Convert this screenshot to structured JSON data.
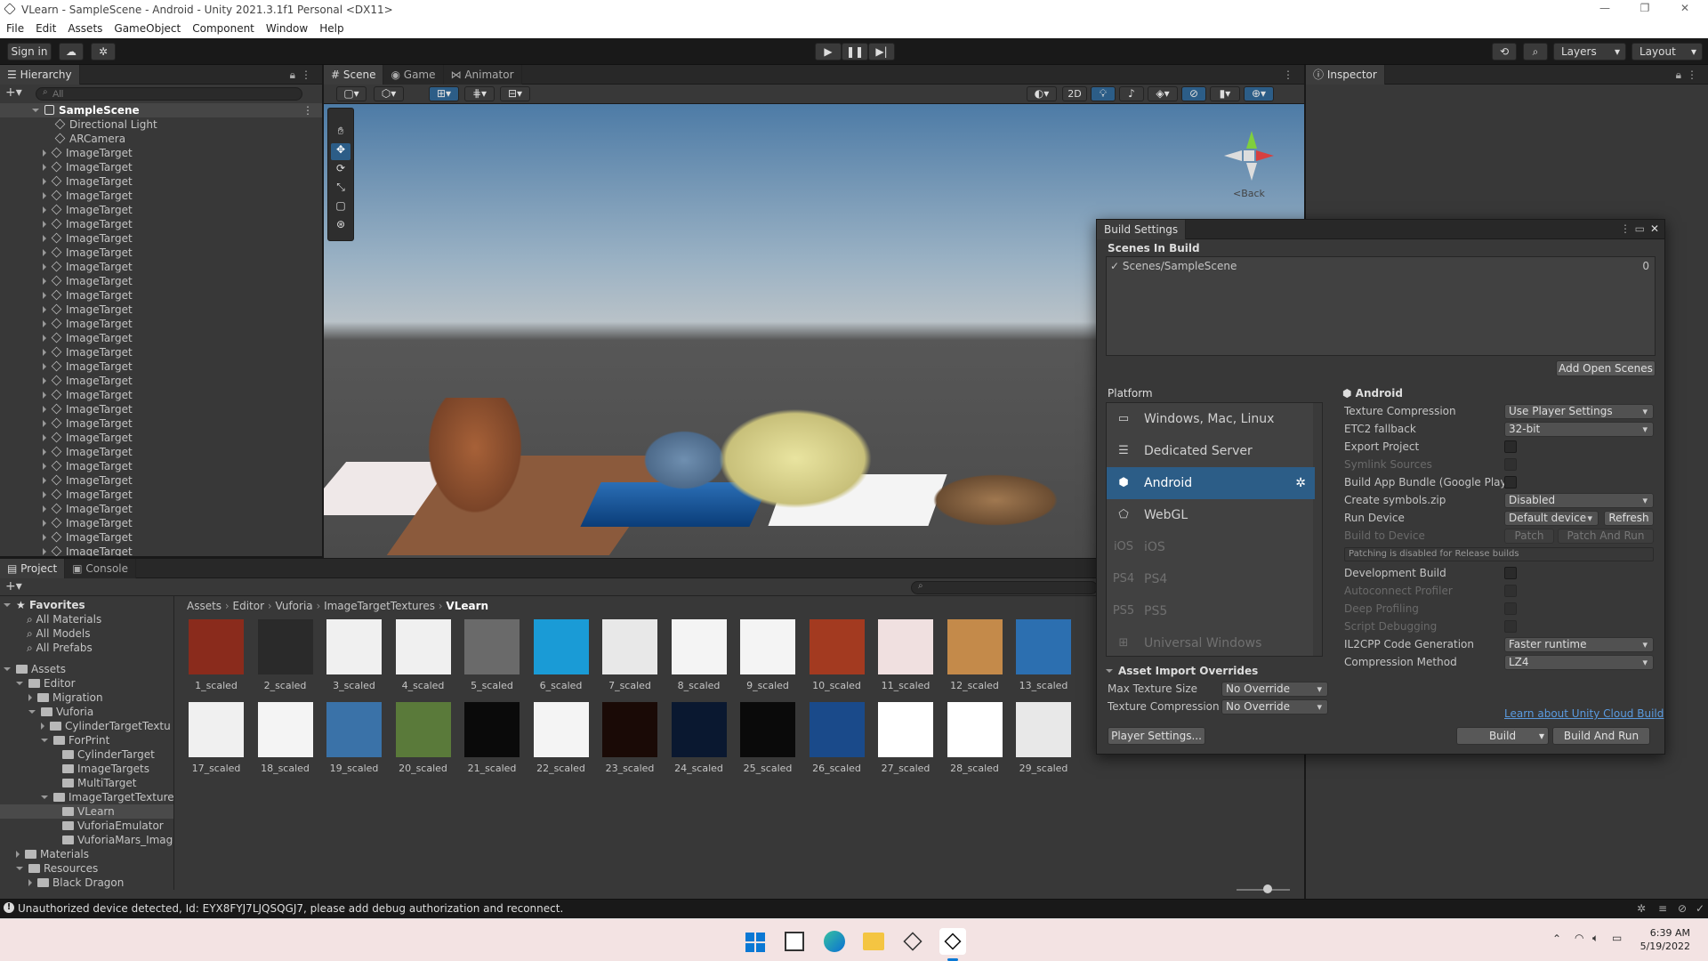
{
  "window": {
    "title": "VLearn - SampleScene - Android - Unity 2021.3.1f1 Personal <DX11>"
  },
  "menu": [
    "File",
    "Edit",
    "Assets",
    "GameObject",
    "Component",
    "Window",
    "Help"
  ],
  "toolbar": {
    "sign_in": "Sign in",
    "layers": "Layers",
    "layout": "Layout"
  },
  "hierarchy": {
    "tab": "Hierarchy",
    "search_placeholder": "All",
    "scene": "SampleScene",
    "items": [
      "Directional Light",
      "ARCamera"
    ],
    "image_target": "ImageTarget",
    "image_target_count": 29
  },
  "scene_tabs": {
    "scene": "Scene",
    "game": "Game",
    "animator": "Animator"
  },
  "scene_view": {
    "mode_2d": "2D",
    "back_label": "Back"
  },
  "inspector": {
    "tab": "Inspector"
  },
  "build": {
    "title": "Build Settings",
    "scenes_in_build": "Scenes In Build",
    "scene_entry": "Scenes/SampleScene",
    "scene_index": "0",
    "add_open_scenes": "Add Open Scenes",
    "platform_label": "Platform",
    "platforms": [
      {
        "name": "Windows, Mac, Linux",
        "icon": "monitor-icon"
      },
      {
        "name": "Dedicated Server",
        "icon": "server-icon"
      },
      {
        "name": "Android",
        "icon": "android-icon",
        "selected": true
      },
      {
        "name": "WebGL",
        "icon": "html5-icon"
      },
      {
        "name": "iOS",
        "icon": "ios-icon",
        "glyph": "iOS"
      },
      {
        "name": "PS4",
        "icon": "ps4-icon",
        "glyph": "PS4"
      },
      {
        "name": "PS5",
        "icon": "ps5-icon",
        "glyph": "PS5"
      },
      {
        "name": "Universal Windows Platform",
        "icon": "windows-icon"
      }
    ],
    "android_label": "Android",
    "settings": {
      "texture_compression": "Texture Compression",
      "texture_compression_value": "Use Player Settings",
      "etc2": "ETC2 fallback",
      "etc2_value": "32-bit",
      "export_project": "Export Project",
      "symlink": "Symlink Sources",
      "app_bundle": "Build App Bundle (Google Play)",
      "symbols": "Create symbols.zip",
      "symbols_value": "Disabled",
      "run_device": "Run Device",
      "run_device_value": "Default device",
      "refresh": "Refresh",
      "build_to_device": "Build to Device",
      "patch": "Patch",
      "patch_and_run": "Patch And Run",
      "patching_note": "Patching is disabled for Release builds",
      "dev_build": "Development Build",
      "autoconnect": "Autoconnect Profiler",
      "deep_profiling": "Deep Profiling",
      "script_debugging": "Script Debugging",
      "il2cpp": "IL2CPP Code Generation",
      "il2cpp_value": "Faster runtime",
      "compression": "Compression Method",
      "compression_value": "LZ4"
    },
    "asset_import": {
      "title": "Asset Import Overrides",
      "max_texture": "Max Texture Size",
      "max_texture_value": "No Override",
      "tex_comp": "Texture Compression",
      "tex_comp_value": "No Override"
    },
    "player_settings": "Player Settings...",
    "cloud_link": "Learn about Unity Cloud Build",
    "build_btn": "Build",
    "build_and_run": "Build And Run"
  },
  "project": {
    "tab_project": "Project",
    "tab_console": "Console",
    "favorites": "Favorites",
    "fav_items": [
      "All Materials",
      "All Models",
      "All Prefabs"
    ],
    "tree": [
      {
        "label": "Assets",
        "level": 0,
        "open": true
      },
      {
        "label": "Editor",
        "level": 1,
        "open": true
      },
      {
        "label": "Migration",
        "level": 2
      },
      {
        "label": "Vuforia",
        "level": 2,
        "open": true
      },
      {
        "label": "CylinderTargetTextu",
        "level": 3
      },
      {
        "label": "ForPrint",
        "level": 3,
        "open": true
      },
      {
        "label": "CylinderTarget",
        "level": 4
      },
      {
        "label": "ImageTargets",
        "level": 4
      },
      {
        "label": "MultiTarget",
        "level": 4
      },
      {
        "label": "ImageTargetTextures",
        "level": 3,
        "open": true
      },
      {
        "label": "VLearn",
        "level": 4,
        "selected": true
      },
      {
        "label": "VuforiaEmulator",
        "level": 4
      },
      {
        "label": "VuforiaMars_Image",
        "level": 4
      },
      {
        "label": "Materials",
        "level": 1
      },
      {
        "label": "Resources",
        "level": 1,
        "open": true
      },
      {
        "label": "Black Dragon",
        "level": 2
      }
    ],
    "breadcrumb": [
      "Assets",
      "Editor",
      "Vuforia",
      "ImageTargetTextures",
      "VLearn"
    ],
    "assets": [
      "1_scaled",
      "2_scaled",
      "3_scaled",
      "4_scaled",
      "5_scaled",
      "6_scaled",
      "7_scaled",
      "8_scaled",
      "9_scaled",
      "10_scaled",
      "11_scaled",
      "12_scaled",
      "13_scaled",
      "17_scaled",
      "18_scaled",
      "19_scaled",
      "20_scaled",
      "21_scaled",
      "22_scaled",
      "23_scaled",
      "24_scaled",
      "25_scaled",
      "26_scaled",
      "27_scaled",
      "28_scaled",
      "29_scaled"
    ],
    "asset_colors": [
      "#8a2b1c",
      "#2a2a2a",
      "#f0f0f0",
      "#f0f0f0",
      "#6a6a6a",
      "#1a9bd6",
      "#e8e8e8",
      "#f4f4f4",
      "#f4f4f4",
      "#a33a20",
      "#f0e0e0",
      "#c48a4a",
      "#2c6fb0",
      "#f0f0f0",
      "#f4f4f4",
      "#3a72a8",
      "#5a7a3a",
      "#0a0a0a",
      "#f4f4f4",
      "#1a0a06",
      "#0a1830",
      "#0a0a0a",
      "#1a4a8a",
      "#ffffff",
      "#ffffff",
      "#e8e8e8"
    ]
  },
  "status": {
    "message": "Unauthorized device detected, Id: EYX8FYJ7LJQSQGJ7, please add debug authorization and reconnect."
  },
  "taskbar": {
    "time": "6:39 AM",
    "date": "5/19/2022"
  }
}
